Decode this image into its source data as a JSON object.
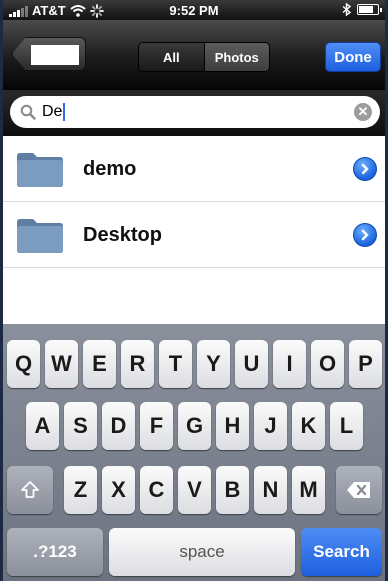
{
  "status_bar": {
    "carrier": "AT&T",
    "time": "9:52 PM"
  },
  "nav_bar": {
    "segments": [
      "All",
      "Photos"
    ],
    "active_segment": "Photos",
    "done_label": "Done"
  },
  "search": {
    "value": "De"
  },
  "results": [
    {
      "label": "demo"
    },
    {
      "label": "Desktop"
    }
  ],
  "keyboard": {
    "row1": [
      "Q",
      "W",
      "E",
      "R",
      "T",
      "Y",
      "U",
      "I",
      "O",
      "P"
    ],
    "row2": [
      "A",
      "S",
      "D",
      "F",
      "G",
      "H",
      "J",
      "K",
      "L"
    ],
    "row3": [
      "Z",
      "X",
      "C",
      "V",
      "B",
      "N",
      "M"
    ],
    "numbers_label": ".?123",
    "space_label": "space",
    "search_label": "Search"
  },
  "colors": {
    "accent": "#1d5fe0",
    "folder": "#6f8fb2"
  },
  "icons": [
    "signal-icon",
    "wifi-icon",
    "activity-icon",
    "bluetooth-icon",
    "battery-icon",
    "search-icon",
    "clear-icon",
    "folder-icon",
    "disclosure-icon",
    "shift-icon",
    "delete-icon"
  ]
}
